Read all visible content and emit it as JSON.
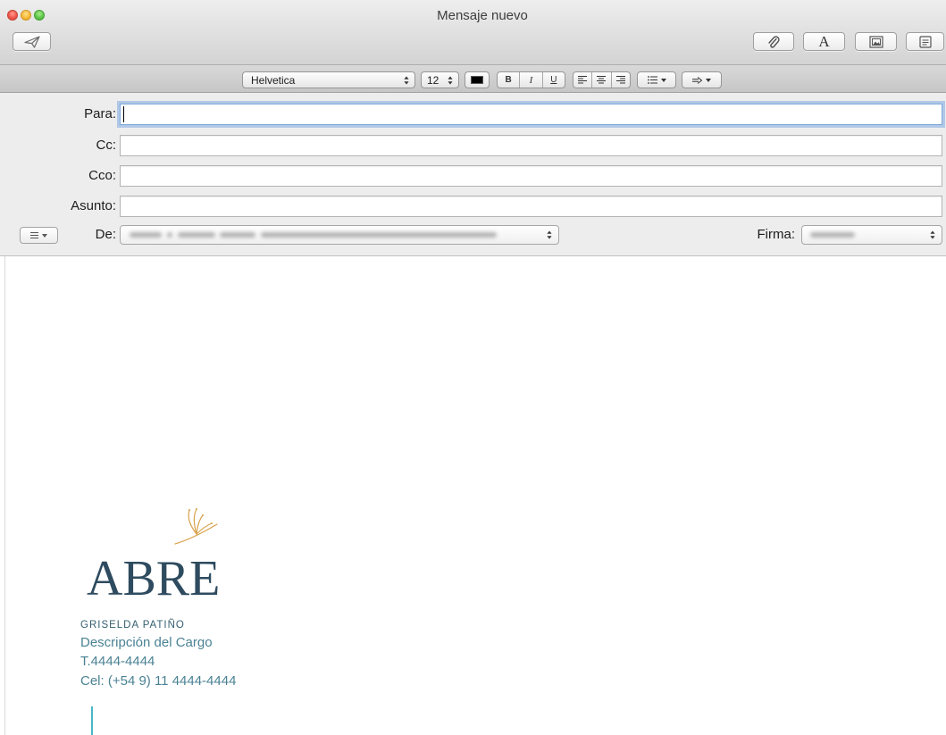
{
  "window": {
    "title": "Mensaje nuevo"
  },
  "toolbar": {
    "send_icon": "paper-plane-icon",
    "attach_icon": "paperclip-icon",
    "fonts_label": "A",
    "photos_icon": "photo-browser-icon",
    "stationery_icon": "stationery-icon"
  },
  "format_bar": {
    "font_family": "Helvetica",
    "font_size": "12",
    "text_color": "#000000",
    "bold_label": "B",
    "italic_label": "I",
    "underline_label": "U",
    "align_icons": [
      "align-left-icon",
      "align-center-icon",
      "align-right-icon"
    ],
    "list_icon": "bulleted-list-icon",
    "indent_icon": "indent-arrow-icon"
  },
  "header_fields": {
    "to": {
      "label": "Para:",
      "value": ""
    },
    "cc": {
      "label": "Cc:",
      "value": ""
    },
    "bcc": {
      "label": "Cco:",
      "value": ""
    },
    "subject": {
      "label": "Asunto:",
      "value": ""
    },
    "from": {
      "label": "De:"
    },
    "signature": {
      "label": "Firma:"
    },
    "customize_icon": "header-fields-menu-icon"
  },
  "message_body": {
    "signature": {
      "logo_text": "ABRE",
      "name": "GRISELDA PATIÑO",
      "job_title": "Descripción del Cargo",
      "phone": "T.4444-4444",
      "mobile": "Cel: (+54 9) 11 4444-4444"
    }
  },
  "colors": {
    "logo_text": "#2e4b5f",
    "logo_mark": "#d7a24c",
    "signature_name": "#355f70",
    "signature_text": "#4a8294",
    "signature_rule": "#49b7c6"
  }
}
